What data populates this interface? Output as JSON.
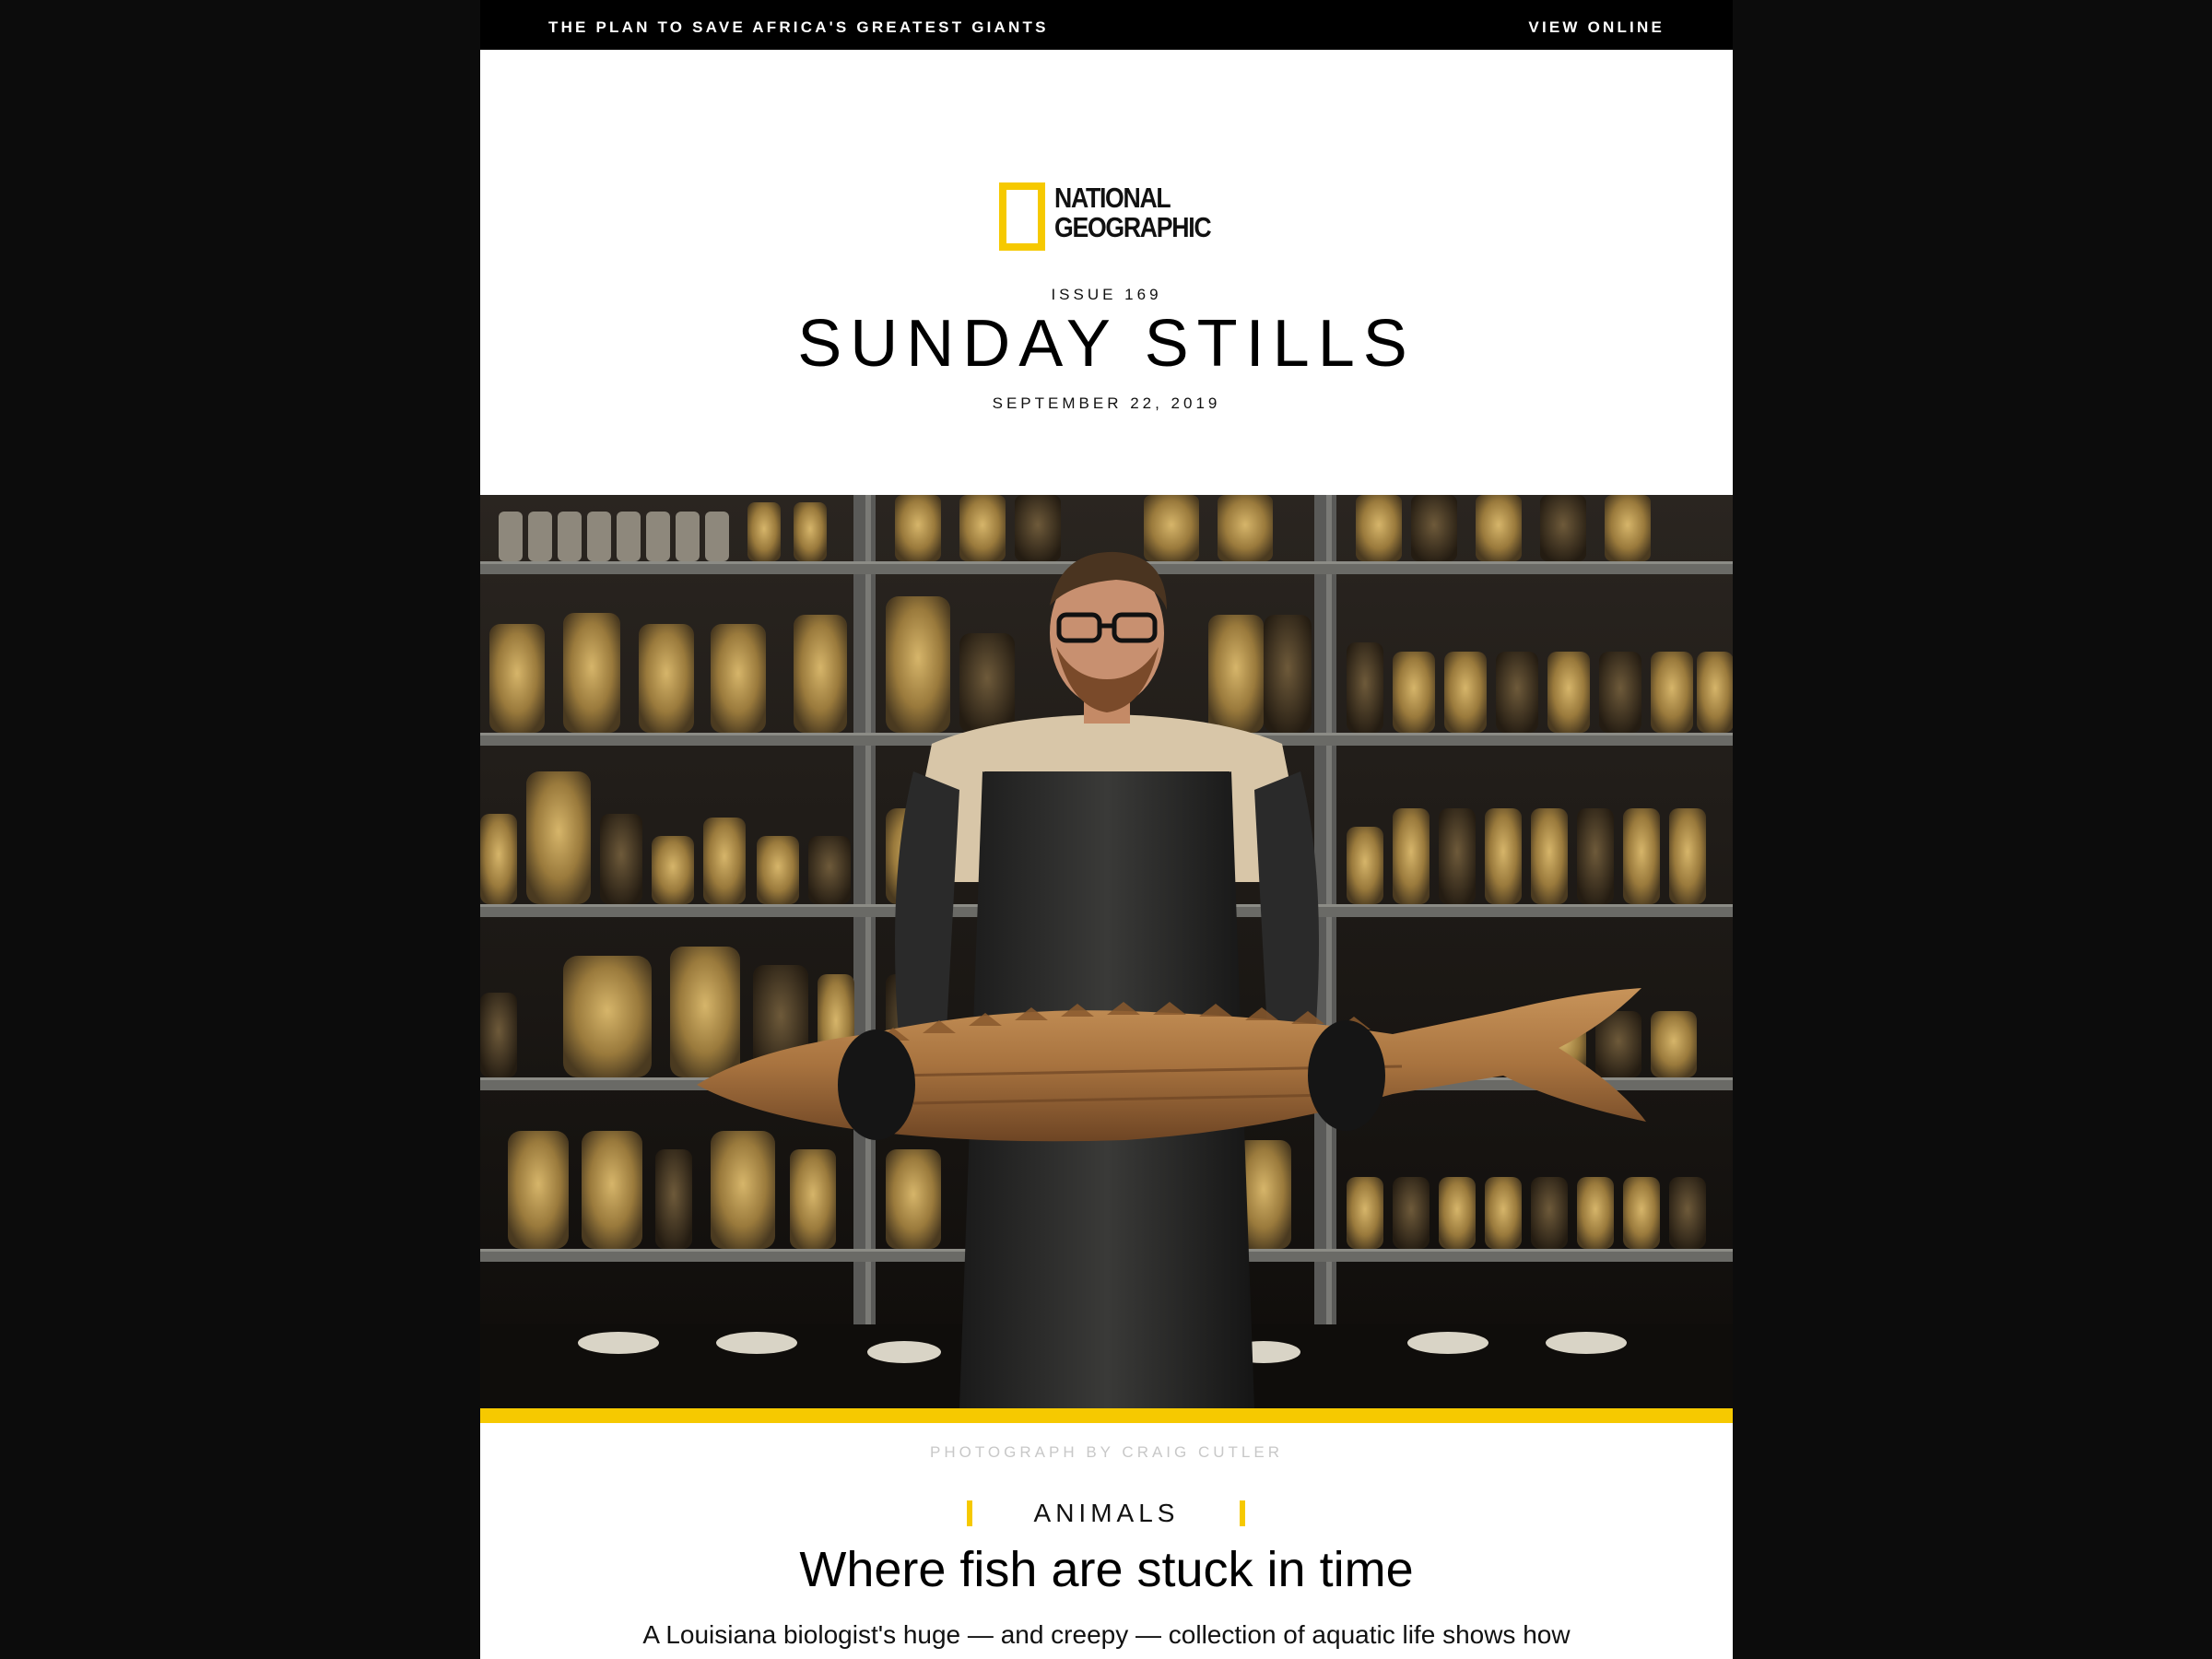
{
  "topbar": {
    "preheader": "THE PLAN TO SAVE AFRICA'S GREATEST GIANTS",
    "view_online": "VIEW ONLINE"
  },
  "masthead": {
    "logo_text_line1": "NATIONAL",
    "logo_text_line2": "GEOGRAPHIC",
    "issue": "ISSUE 169",
    "title": "SUNDAY STILLS",
    "date": "SEPTEMBER 22, 2019"
  },
  "hero": {
    "alt": "Biologist in apron holding a preserved sturgeon in front of shelves of specimen jars"
  },
  "credit": "PHOTOGRAPH BY CRAIG CUTLER",
  "story": {
    "section": "ANIMALS",
    "headline": "Where fish are stuck in time",
    "dek": "A Louisiana biologist's huge — and creepy — collection of aquatic life shows how"
  },
  "colors": {
    "page_background": "#0c0c0c",
    "brand_yellow": "#f6c900",
    "topbar": "#000000"
  }
}
